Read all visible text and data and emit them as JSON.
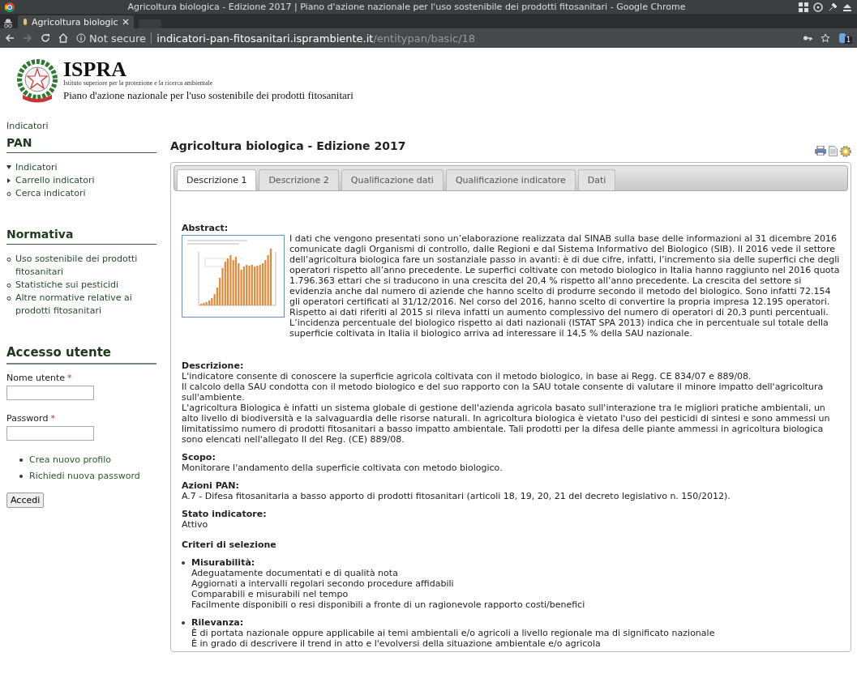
{
  "browser": {
    "title": "Agricoltura biologica - Edizione 2017 | Piano d'azione nazionale per l'uso sostenibile dei prodotti fitosanitari - Google Chrome",
    "tab_title": "Agricoltura biologic",
    "security_label": "Not secure",
    "url_host": "indicatori-pan-fitosanitari.isprambiente.it",
    "url_path": "/entitypan/basic/18",
    "extension_badge": "1"
  },
  "header": {
    "logo_title": "ISPRA",
    "logo_subtitle": "Istituto superiore per la protezione e la ricerca ambientale",
    "site_name": "Piano d'azione nazionale per l'uso sostenibile dei prodotti fitosanitari"
  },
  "breadcrumb": "Indicatori",
  "sidebar": {
    "blocks": [
      {
        "title": "PAN",
        "items": [
          {
            "label": "Indicatori",
            "kind": "expanded"
          },
          {
            "label": "Carrello indicatori",
            "kind": "collapsed"
          },
          {
            "label": "Cerca indicatori",
            "kind": "leaf"
          }
        ]
      },
      {
        "title": "Normativa",
        "items": [
          {
            "label": "Uso sostenibile dei prodotti fitosanitari",
            "kind": "leaf"
          },
          {
            "label": "Statistiche sui pesticidi",
            "kind": "leaf"
          },
          {
            "label": "Altre normative relative ai prodotti fitosanitari",
            "kind": "leaf"
          }
        ]
      }
    ],
    "login": {
      "title": "Accesso utente",
      "fields": [
        {
          "label": "Nome utente",
          "required_mark": "*"
        },
        {
          "label": "Password",
          "required_mark": "*"
        }
      ],
      "links": [
        "Crea nuovo profilo",
        "Richiedi nuova password"
      ],
      "button": "Accedi"
    }
  },
  "content": {
    "title": "Agricoltura biologica - Edizione 2017",
    "tabs": [
      {
        "label": "Descrizione 1",
        "selected": true
      },
      {
        "label": "Descrizione 2",
        "selected": false
      },
      {
        "label": "Qualificazione dati",
        "selected": false
      },
      {
        "label": "Qualificazione indicatore",
        "selected": false
      },
      {
        "label": "Dati",
        "selected": false
      }
    ],
    "abstract": {
      "heading": "Abstract:",
      "text": "I dati che vengono presentati sono un’elaborazione realizzata dal SINAB sulla base delle informazioni al 31 dicembre 2016 comunicate dagli Organismi di controllo, dalle Regioni e dal Sistema Informativo del Biologico (SIB). Il 2016 vede il settore dell’agricoltura biologica fare un sostanziale passo in avanti: è di due cifre, infatti, l’incremento sia delle superfici che degli operatori rispetto all’anno precedente. Le superfici coltivate con metodo biologico in Italia hanno raggiunto nel 2016 quota 1.796.363 ettari che si traducono in una crescita del 20,4 % rispetto all’anno precedente. La crescita del settore si evidenzia anche dal numero di aziende che hanno scelto di produrre secondo il metodo del biologico. Sono infatti 72.154 gli operatori certificati al 31/12/2016. Nel corso del 2016, hanno scelto di convertire la propria impresa 12.195 operatori. Rispetto ai dati riferiti al 2015 si rileva infatti un aumento complessivo del numero di operatori di 20,3 punti percentuali. L’incidenza percentuale del biologico rispetto ai dati nazionali (ISTAT SPA 2013) indica che in percentuale sul totale della superficie coltivata in Italia il biologico arriva ad interessare il 14,5 % della SAU nazionale."
    },
    "sections": [
      {
        "heading": "Descrizione:",
        "paragraphs": [
          "L'indicatore consente di conoscere la superficie agricola coltivata con il metodo biologico, in base ai Regg. CE 834/07 e 889/08.",
          "Il calcolo della SAU condotta con il metodo biologico e del suo rapporto con la SAU totale consente di valutare il minore impatto dell'agricoltura sull'ambiente.",
          "L'agricoltura Biologica è infatti un sistema globale di gestione dell'azienda agricola basato sull'interazione tra le migliori pratiche ambientali, un alto livello di biodiversità e la salvaguardia delle risorse naturali. In agricoltura biologica è vietato l'uso dei pesticidi di sintesi e sono ammessi un limitatissimo numero di prodotti fitosanitari a basso impatto ambientale. Tali prodotti per la difesa delle piante ammessi in agricoltura biologica sono elencati nell'allegato II del Reg. (CE) 889/08."
        ]
      },
      {
        "heading": "Scopo:",
        "paragraphs": [
          "Monitorare l'andamento della superficie coltivata con metodo biologico."
        ]
      },
      {
        "heading": "Azioni PAN:",
        "paragraphs": [
          "A.7 - Difesa fitosanitaria a basso apporto di prodotti fitosanitari (articoli 18, 19, 20, 21 del decreto legislativo n. 150/2012)."
        ]
      },
      {
        "heading": "Stato indicatore:",
        "paragraphs": [
          "Attivo"
        ]
      }
    ],
    "criteria": {
      "heading": "Criteri di selezione",
      "groups": [
        {
          "title": "Misurabilità:",
          "items": [
            "Adeguatamente documentati e di qualità nota",
            "Aggiornati a intervalli regolari secondo procedure affidabili",
            "Comparabili e misurabili nel tempo",
            "Facilmente disponibili o resi disponibili a fronte di un ragionevole rapporto costi/benefici"
          ]
        },
        {
          "title": "Rilevanza:",
          "items": [
            "È di portata nazionale oppure applicabile ai temi ambientali e/o agricoli a livello regionale ma di significato nazionale",
            "È in grado di descrivere il trend in atto e l'evolversi della situazione ambientale e/o agricola"
          ]
        }
      ]
    }
  }
}
